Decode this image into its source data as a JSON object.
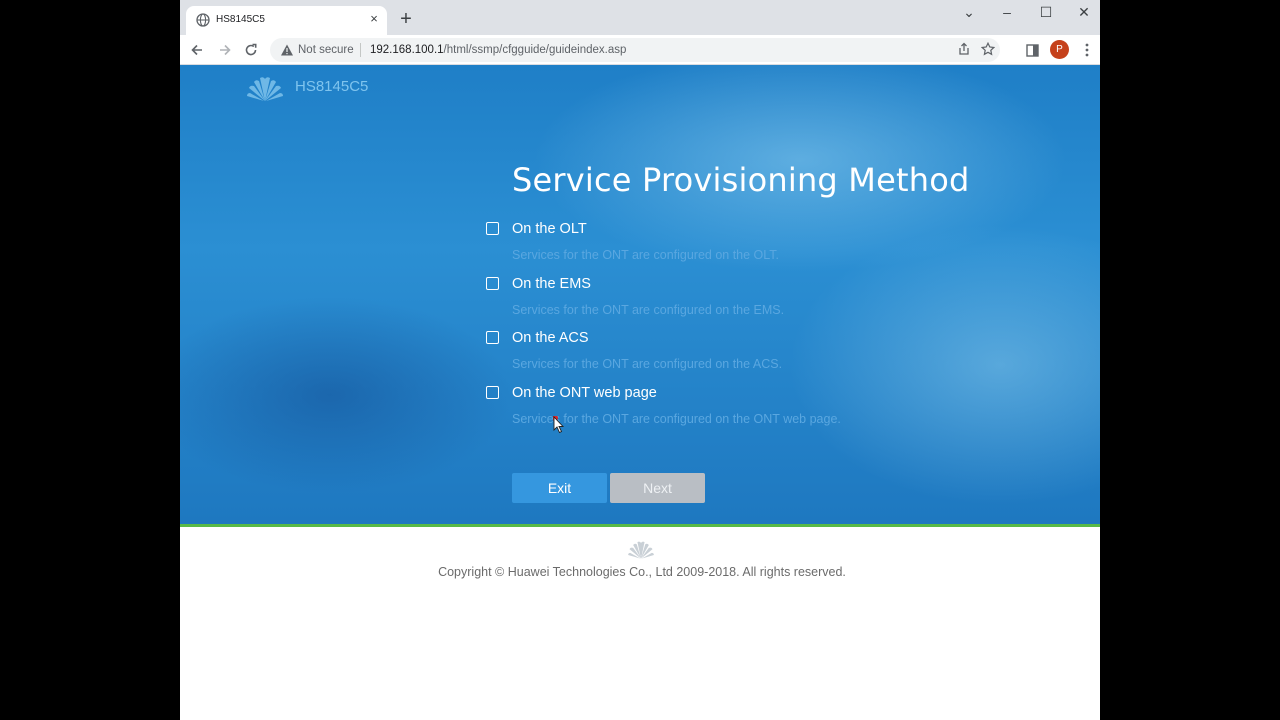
{
  "browser": {
    "tab": {
      "title": "HS8145C5",
      "close": "×"
    },
    "new_tab": "+",
    "window_controls": {
      "minimize": "–",
      "maximize": "☐",
      "close": "✕",
      "tab_search": "⌄"
    },
    "address_bar": {
      "security_text": "Not secure",
      "url_host": "192.168.100.1",
      "url_path": "/html/ssmp/cfgguide/guideindex.asp"
    },
    "profile_initial": "P"
  },
  "page": {
    "model": "HS8145C5",
    "title": "Service Provisioning Method",
    "options": [
      {
        "label": "On the OLT",
        "description": "Services for the ONT are configured on the OLT.",
        "checked": false
      },
      {
        "label": "On the EMS",
        "description": "Services for the ONT are configured on the EMS.",
        "checked": false
      },
      {
        "label": "On the ACS",
        "description": "Services for the ONT are configured on the ACS.",
        "checked": false
      },
      {
        "label": "On the ONT web page",
        "description": "Services for the ONT are configured on the ONT web page.",
        "checked": false
      }
    ],
    "buttons": {
      "exit": "Exit",
      "next": "Next"
    },
    "footer": {
      "copyright": "Copyright © Huawei Technologies Co., Ltd 2009-2018. All rights reserved."
    }
  },
  "colors": {
    "hero_blue": "#2b8fd3",
    "accent_green": "#58b947",
    "button_blue": "#3597df",
    "button_disabled": "#b9bec4",
    "profile_avatar": "#c5411b"
  },
  "icons": [
    "globe-icon",
    "close-icon",
    "plus-icon",
    "back-icon",
    "forward-icon",
    "reload-icon",
    "warning-icon",
    "share-icon",
    "star-icon",
    "side-panel-icon",
    "menu-icon",
    "huawei-logo-icon",
    "cursor-icon"
  ]
}
